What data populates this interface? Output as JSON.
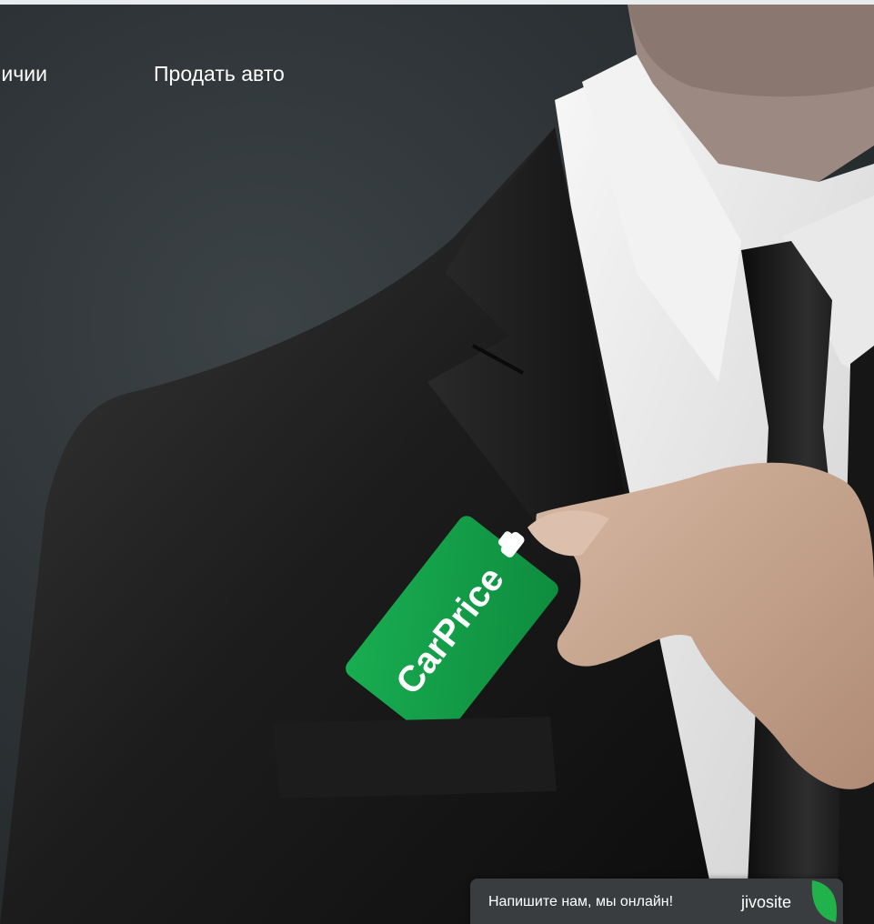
{
  "nav": {
    "partial_label": "личии",
    "sell_label": "Продать авто"
  },
  "card": {
    "brand": "CarPrice"
  },
  "chat": {
    "message": "Напишите нам, мы онлайн!",
    "brand": "jivosite"
  },
  "colors": {
    "background": "#2c3134",
    "card_green": "#12a24a",
    "chat_bg": "#3a3d40",
    "leaf_green": "#21b24b"
  },
  "icons": {
    "card_logo": "car-icon",
    "chat_logo": "leaf-icon"
  }
}
